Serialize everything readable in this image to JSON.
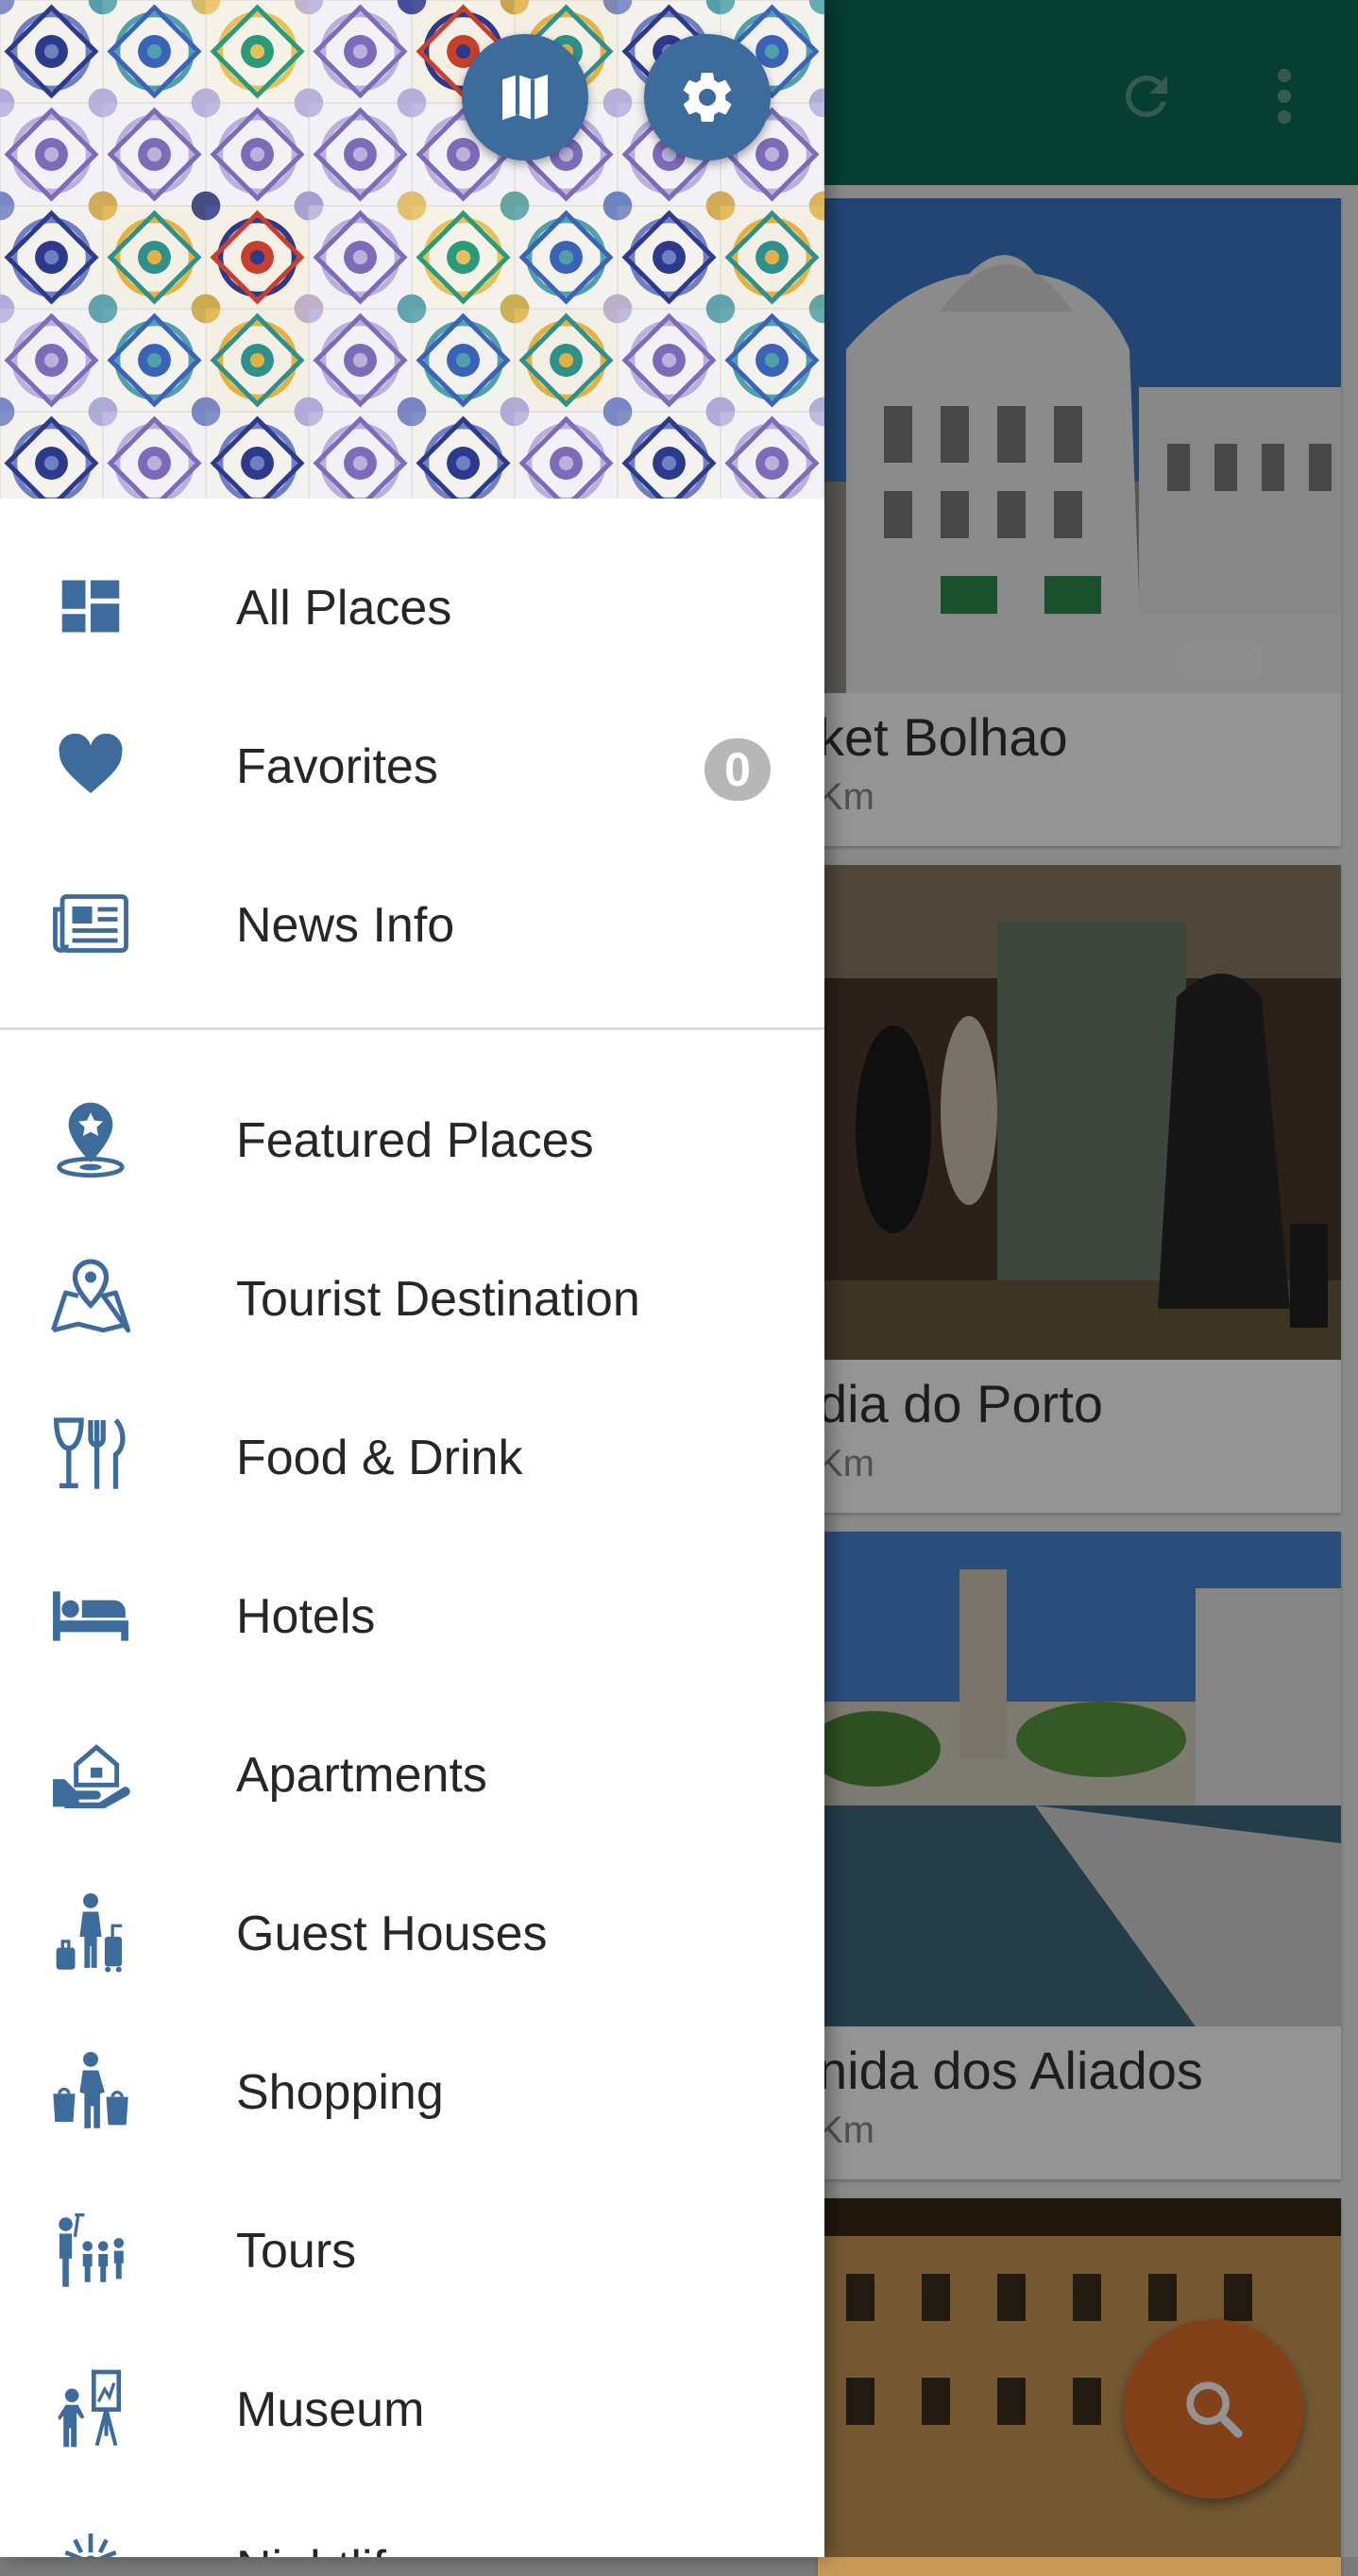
{
  "colors": {
    "toolbar": "#0c6b56",
    "accent_icon": "#3d6b9c",
    "fab": "#e0702a",
    "badge": "#b7b7b7"
  },
  "toolbar": {
    "refresh_icon": "refresh-icon",
    "overflow_icon": "more-vert-icon"
  },
  "cards": [
    {
      "title": "ket Bolhao",
      "distance": "Km"
    },
    {
      "title": "dia do Porto",
      "distance": "Km"
    },
    {
      "title": "nida dos Aliados",
      "distance": "Km"
    }
  ],
  "drawer": {
    "header_buttons": [
      "map-icon",
      "settings-icon"
    ],
    "primary_items": [
      {
        "label": "All Places",
        "icon": "dashboard-icon"
      },
      {
        "label": "Favorites",
        "icon": "heart-icon",
        "badge": "0"
      },
      {
        "label": "News Info",
        "icon": "newspaper-icon"
      }
    ],
    "category_items": [
      {
        "label": "Featured Places",
        "icon": "featured-place-icon"
      },
      {
        "label": "Tourist Destination",
        "icon": "map-pin-icon"
      },
      {
        "label": "Food & Drink",
        "icon": "food-drink-icon"
      },
      {
        "label": "Hotels",
        "icon": "bed-icon"
      },
      {
        "label": "Apartments",
        "icon": "apartment-icon"
      },
      {
        "label": "Guest Houses",
        "icon": "luggage-icon"
      },
      {
        "label": "Shopping",
        "icon": "shopping-icon"
      },
      {
        "label": "Tours",
        "icon": "tour-group-icon"
      },
      {
        "label": "Museum",
        "icon": "museum-icon"
      },
      {
        "label": "Nightlif",
        "icon": "nightlife-icon"
      }
    ]
  },
  "fab": {
    "icon": "search-icon"
  }
}
